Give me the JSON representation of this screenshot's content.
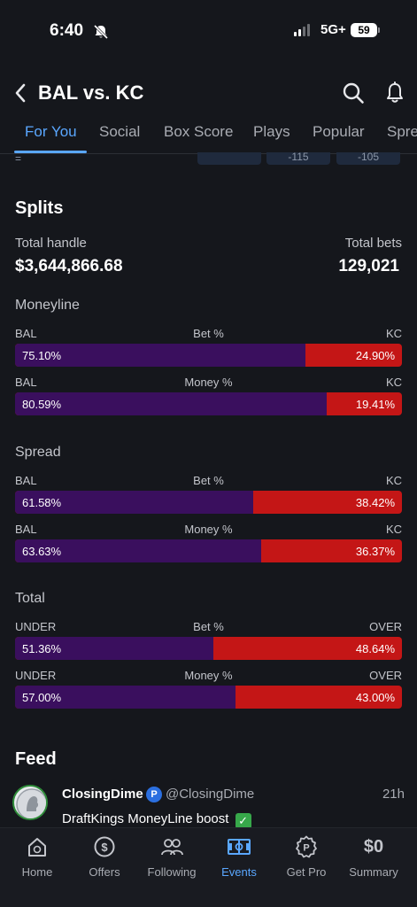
{
  "status_bar": {
    "time": "6:40",
    "network": "5G+",
    "battery": "59"
  },
  "header": {
    "title": "BAL vs. KC"
  },
  "tabs": [
    {
      "label": "For You",
      "active": true
    },
    {
      "label": "Social"
    },
    {
      "label": "Box Score"
    },
    {
      "label": "Plays"
    },
    {
      "label": "Popular"
    },
    {
      "label": "Spre"
    }
  ],
  "odds_strip": {
    "dash": "=",
    "chips": [
      "",
      "-115",
      "-105"
    ]
  },
  "splits": {
    "title": "Splits",
    "total_handle_label": "Total handle",
    "total_handle_value": "$3,644,866.68",
    "total_bets_label": "Total bets",
    "total_bets_value": "129,021",
    "groups": [
      {
        "title": "Moneyline",
        "rows": [
          {
            "left_team": "BAL",
            "metric": "Bet %",
            "right_team": "KC",
            "left_value": "75.10%",
            "right_value": "24.90%",
            "left_pct": 75.1
          },
          {
            "left_team": "BAL",
            "metric": "Money %",
            "right_team": "KC",
            "left_value": "80.59%",
            "right_value": "19.41%",
            "left_pct": 80.59
          }
        ]
      },
      {
        "title": "Spread",
        "rows": [
          {
            "left_team": "BAL",
            "metric": "Bet %",
            "right_team": "KC",
            "left_value": "61.58%",
            "right_value": "38.42%",
            "left_pct": 61.58
          },
          {
            "left_team": "BAL",
            "metric": "Money %",
            "right_team": "KC",
            "left_value": "63.63%",
            "right_value": "36.37%",
            "left_pct": 63.63
          }
        ]
      },
      {
        "title": "Total",
        "rows": [
          {
            "left_team": "UNDER",
            "metric": "Bet %",
            "right_team": "OVER",
            "left_value": "51.36%",
            "right_value": "48.64%",
            "left_pct": 51.36
          },
          {
            "left_team": "UNDER",
            "metric": "Money %",
            "right_team": "OVER",
            "left_value": "57.00%",
            "right_value": "43.00%",
            "left_pct": 57.0
          }
        ]
      }
    ]
  },
  "feed": {
    "title": "Feed",
    "items": [
      {
        "name": "ClosingDime",
        "verified_mark": "P",
        "handle": "@ClosingDime",
        "time": "21h",
        "text": "DraftKings MoneyLine boost",
        "emoji": "✓"
      }
    ]
  },
  "bottom_nav": [
    {
      "label": "Home",
      "icon": "home-icon"
    },
    {
      "label": "Offers",
      "icon": "offers-icon"
    },
    {
      "label": "Following",
      "icon": "following-icon"
    },
    {
      "label": "Events",
      "icon": "events-icon",
      "active": true
    },
    {
      "label": "Get Pro",
      "icon": "get-pro-icon"
    },
    {
      "label": "Summary",
      "icon": "summary-icon",
      "value": "$0"
    }
  ],
  "colors": {
    "accent": "#5aa7ff",
    "left_bar": "#3a0f5e",
    "right_bar": "#c41616",
    "background": "#15171c"
  }
}
